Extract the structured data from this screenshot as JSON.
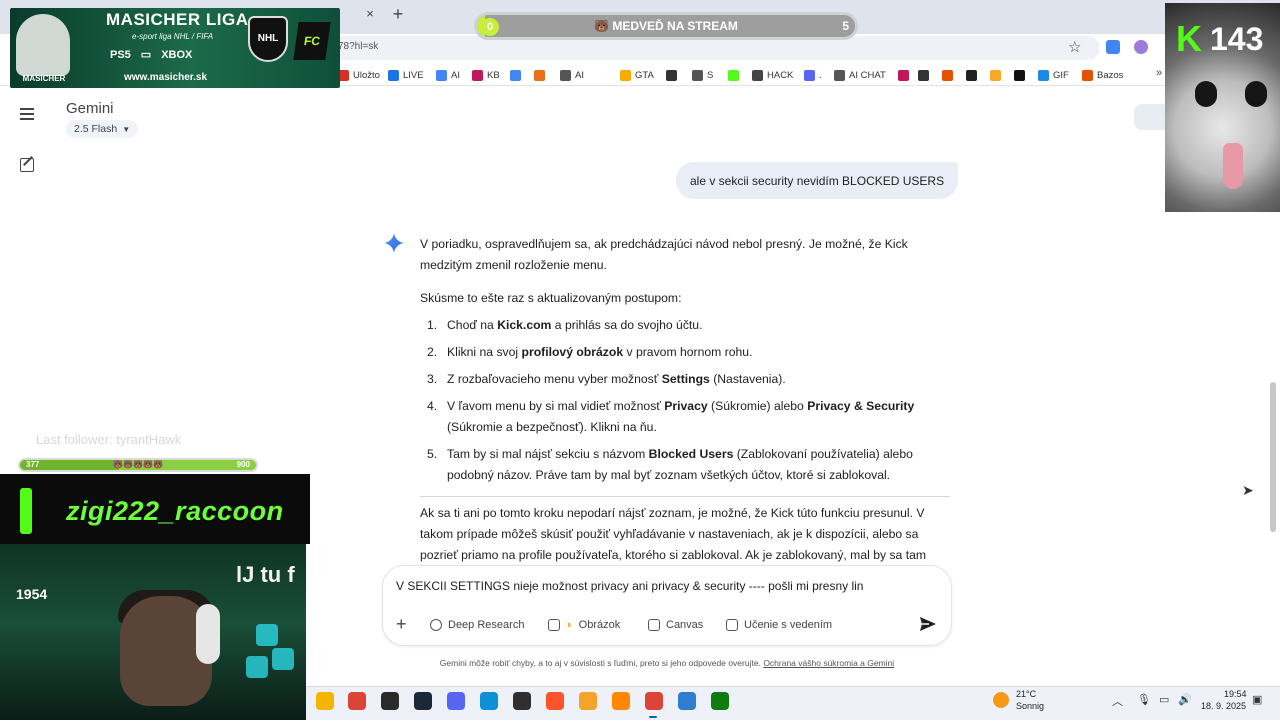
{
  "browser": {
    "address_url": "78?hl=sk",
    "tab_close": "×",
    "new_tab": "+",
    "bookmarks": [
      {
        "label": "Uložto",
        "icon": "uloz-icon",
        "color": "#d93025"
      },
      {
        "label": "LIVE",
        "icon": "live-icon",
        "color": "#1a73e8"
      },
      {
        "label": "AI",
        "icon": "gemini-icon",
        "color": "#4285f4"
      },
      {
        "label": "KB",
        "icon": "kb-icon",
        "color": "#c2185b"
      },
      {
        "label": "",
        "icon": "translate-icon",
        "color": "#4285f4"
      },
      {
        "label": "",
        "icon": "app-icon",
        "color": "#e8711c"
      },
      {
        "label": "AI",
        "icon": "folder-icon",
        "color": "#555555"
      },
      {
        "label": "GTA",
        "icon": "gta-icon",
        "color": "#f9ab00"
      },
      {
        "label": "",
        "icon": "globe-icon",
        "color": "#333333"
      },
      {
        "label": "S",
        "icon": "folder-icon",
        "color": "#555555"
      },
      {
        "label": "",
        "icon": "kick-icon",
        "color": "#53fc18"
      },
      {
        "label": "HACK",
        "icon": "hack-icon",
        "color": "#444444"
      },
      {
        "label": ".",
        "icon": "discord-icon",
        "color": "#5865f2"
      },
      {
        "label": "AI CHAT",
        "icon": "chat-icon",
        "color": "#555555"
      },
      {
        "label": "",
        "icon": "dots-icon",
        "color": "#c2185b"
      },
      {
        "label": "",
        "icon": "globe-icon",
        "color": "#333333"
      },
      {
        "label": "",
        "icon": "chart-icon",
        "color": "#e65100"
      },
      {
        "label": "",
        "icon": "circle-icon",
        "color": "#222222"
      },
      {
        "label": "",
        "icon": "m-icon",
        "color": "#f9a825"
      },
      {
        "label": "",
        "icon": "app-icon",
        "color": "#111111"
      },
      {
        "label": "GIF",
        "icon": "gif-icon",
        "color": "#1e88e5"
      },
      {
        "label": "Bazos",
        "icon": "bazos-icon",
        "color": "#e65100"
      }
    ],
    "bookmarks_more": "»"
  },
  "stream_goal": {
    "label": "🐻 MEDVEĎ NA STREAM",
    "start": "0",
    "end": "5",
    "progress": 0.02,
    "fill_color": "#c6ef3c"
  },
  "overlay": {
    "banner_title": "MASICHER LIGA",
    "banner_sub": "e-sport liga NHL / FIFA",
    "banner_brand": "MASICHER",
    "banner_consoles": [
      "PS5",
      "XBOX"
    ],
    "banner_url": "www.masicher.sk",
    "nhl_badge": "NHL",
    "fc_badge": "FC",
    "kick_count": "143",
    "kick_letter": "K",
    "follow_label": "Last follower: tyrantHawk",
    "follow_start": "377",
    "follow_mid": "🐻🐻🐻🐻🐻",
    "follow_end": "900",
    "follow_progress": 0.42,
    "streamer_name": "zigi222_raccoon",
    "cam_clock": "1954",
    "cam_sign": "lJ tu f"
  },
  "app": {
    "title": "Gemini",
    "model": "2.5 Flash",
    "user_message": "ale v sekcii security nevidím BLOCKED USERS",
    "reply": {
      "p1": "V poriadku, ospravedlňujem sa, ak predchádzajúci návod nebol presný. Je možné, že Kick medzitým zmenil rozloženie menu.",
      "p2": "Skúsme to ešte raz s aktualizovaným postupom:",
      "steps": [
        {
          "num": "1.",
          "a": "Choď na ",
          "b": "Kick.com",
          "c": " a prihlás sa do svojho účtu.",
          "d": "",
          "e": ""
        },
        {
          "num": "2.",
          "a": "Klikni na svoj ",
          "b": "profilový obrázok",
          "c": " v pravom hornom rohu.",
          "d": "",
          "e": ""
        },
        {
          "num": "3.",
          "a": "Z rozbaľovacieho menu vyber možnosť ",
          "b": "Settings",
          "c": " (Nastavenia).",
          "d": "",
          "e": ""
        },
        {
          "num": "4.",
          "a": "V ľavom menu by si mal vidieť možnosť ",
          "b": "Privacy",
          "c": " (Súkromie) alebo ",
          "d": "Privacy & Security",
          "e": " (Súkromie a bezpečnosť). Klikni na ňu."
        },
        {
          "num": "5.",
          "a": "Tam by si mal nájsť sekciu s názvom ",
          "b": "Blocked Users",
          "c": " (Zablokovaní používatelia) alebo podobný názov. Práve tam by mal byť zoznam všetkých účtov, ktoré si zablokoval.",
          "d": "",
          "e": ""
        }
      ],
      "p3": "Ak sa ti ani po tomto kroku nepodarí nájsť zoznam, je možné, že Kick túto funkciu presunul. V takom prípade môžeš skúsiť použiť vyhľadávanie v nastaveniach, ak je k dispozícii, alebo sa pozrieť priamo na profile používateľa, ktorého si zablokoval. Ak je zablokovaný, mal by sa tam"
    },
    "prompt_text": "V SEKCII SETTINGS nieje možnost privacy ani privacy & security ---- pošli mi presny lin",
    "tools": {
      "deep_research": "Deep Research",
      "image": "Obrázok",
      "canvas": "Canvas",
      "guided": "Učenie s vedením"
    },
    "disclaimer_text": "Gemini môže robiť chyby, a to aj v súvislosti s ľuďmi, preto si jeho odpovede overujte.",
    "disclaimer_link": "Ochrana vášho súkromia a Gemini"
  },
  "taskbar": {
    "apps": [
      {
        "name": "file-explorer-icon",
        "color": "#f4b400"
      },
      {
        "name": "chrome-icon",
        "color": "#db4437"
      },
      {
        "name": "epic-games-icon",
        "color": "#2a2a2a"
      },
      {
        "name": "steam-icon",
        "color": "#1b2838"
      },
      {
        "name": "discord-icon",
        "color": "#5865f2"
      },
      {
        "name": "edge-icon",
        "color": "#0f8fd6"
      },
      {
        "name": "obs-icon",
        "color": "#302e31"
      },
      {
        "name": "brave-icon",
        "color": "#fb542b"
      },
      {
        "name": "app-icon",
        "color": "#f4a32b"
      },
      {
        "name": "vlc-icon",
        "color": "#ff8800"
      },
      {
        "name": "chrome-icon",
        "color": "#db4437"
      },
      {
        "name": "window-icon",
        "color": "#2f7dd1"
      },
      {
        "name": "xbox-icon",
        "color": "#107c10"
      }
    ],
    "weather_temp": "21°C",
    "weather_desc": "Sonnig",
    "time": "19:54",
    "date": "18. 9. 2025"
  }
}
